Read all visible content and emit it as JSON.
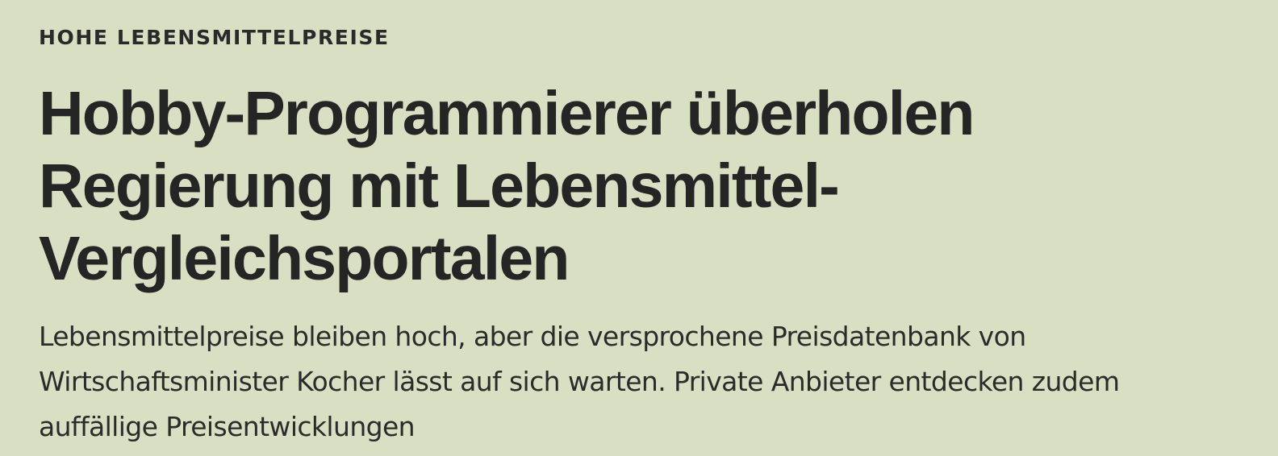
{
  "article": {
    "kicker": "HOHE LEBENSMITTELPREISE",
    "headline": "Hobby-Programmierer überholen Regierung mit Lebensmittel-Vergleichsportalen",
    "lead": "Lebensmittelpreise bleiben hoch, aber die versprochene Preisdatenbank von Wirtschaftsminister Kocher lässt auf sich warten. Private Anbieter entdecken zudem auffällige Preisentwicklungen"
  },
  "colors": {
    "background": "#d9dfc2",
    "text": "#232323"
  }
}
